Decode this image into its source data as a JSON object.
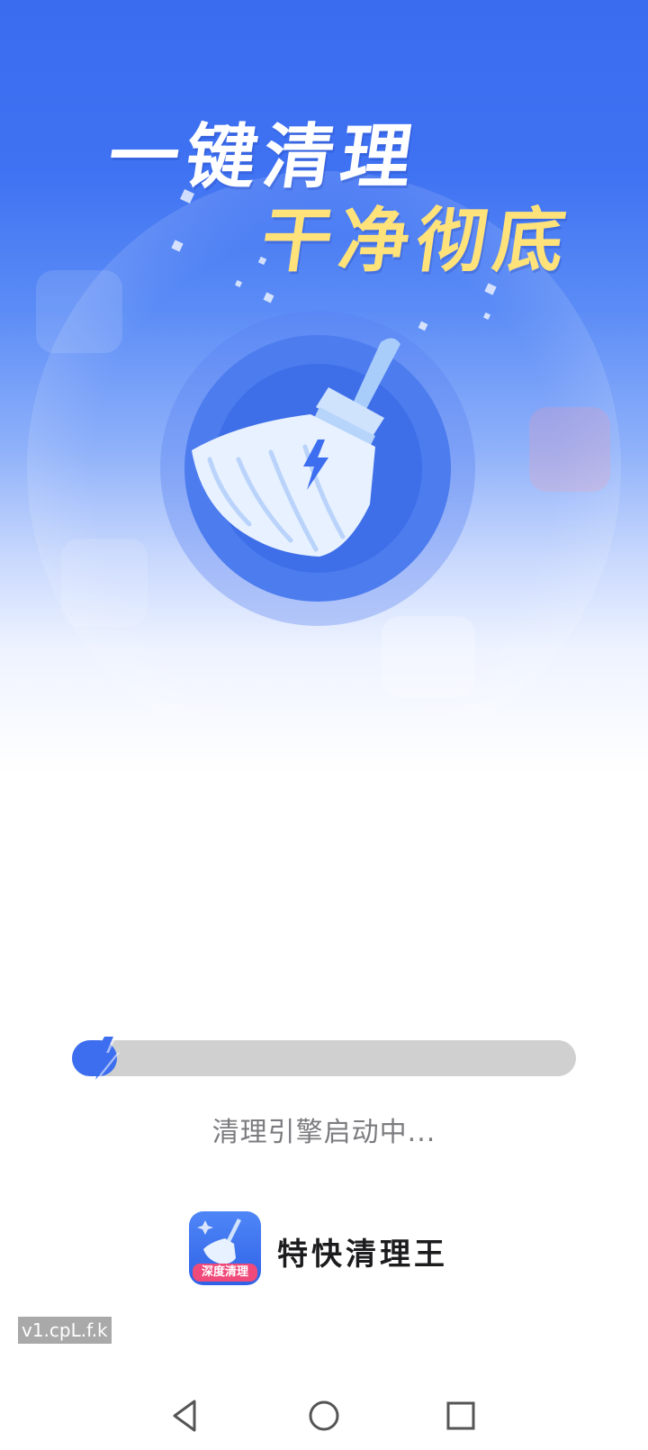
{
  "hero": {
    "headline_line1": "一键清理",
    "headline_line2": "干净彻底",
    "broom_icon": "broom-icon",
    "accent_colors": {
      "blue": "#3d6ef0",
      "yellow": "#ffe27a"
    }
  },
  "loading": {
    "progress_percent": 9,
    "status_text": "清理引擎启动中..."
  },
  "app": {
    "name": "特快清理王",
    "icon_badge": "深度清理",
    "icon": "broom-app-icon"
  },
  "version": "v1.cpL.f.k",
  "nav": {
    "back": "back-triangle-icon",
    "home": "home-circle-icon",
    "recents": "recents-square-icon"
  }
}
